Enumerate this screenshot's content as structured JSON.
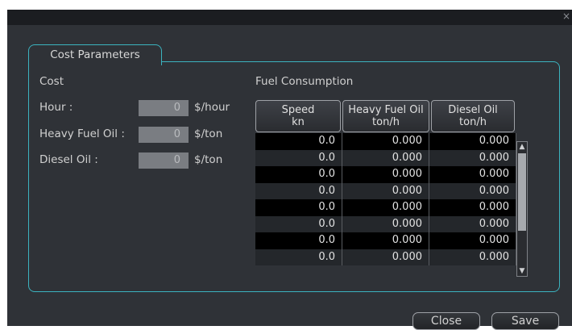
{
  "window": {
    "close_glyph": "×"
  },
  "tab": {
    "label": "Cost Parameters"
  },
  "cost": {
    "heading": "Cost",
    "rows": [
      {
        "label": "Hour :",
        "value": "0",
        "unit": "$/hour"
      },
      {
        "label": "Heavy Fuel Oil :",
        "value": "0",
        "unit": "$/ton"
      },
      {
        "label": "Diesel Oil :",
        "value": "0",
        "unit": "$/ton"
      }
    ]
  },
  "fuel": {
    "heading": "Fuel Consumption",
    "columns": [
      {
        "line1": "Speed",
        "line2": "kn"
      },
      {
        "line1": "Heavy Fuel Oil",
        "line2": "ton/h"
      },
      {
        "line1": "Diesel Oil",
        "line2": "ton/h"
      }
    ],
    "rows": [
      [
        "0.0",
        "0.000",
        "0.000"
      ],
      [
        "0.0",
        "0.000",
        "0.000"
      ],
      [
        "0.0",
        "0.000",
        "0.000"
      ],
      [
        "0.0",
        "0.000",
        "0.000"
      ],
      [
        "0.0",
        "0.000",
        "0.000"
      ],
      [
        "0.0",
        "0.000",
        "0.000"
      ],
      [
        "0.0",
        "0.000",
        "0.000"
      ],
      [
        "0.0",
        "0.000",
        "0.000"
      ]
    ]
  },
  "buttons": {
    "close": "Close",
    "save": "Save"
  }
}
